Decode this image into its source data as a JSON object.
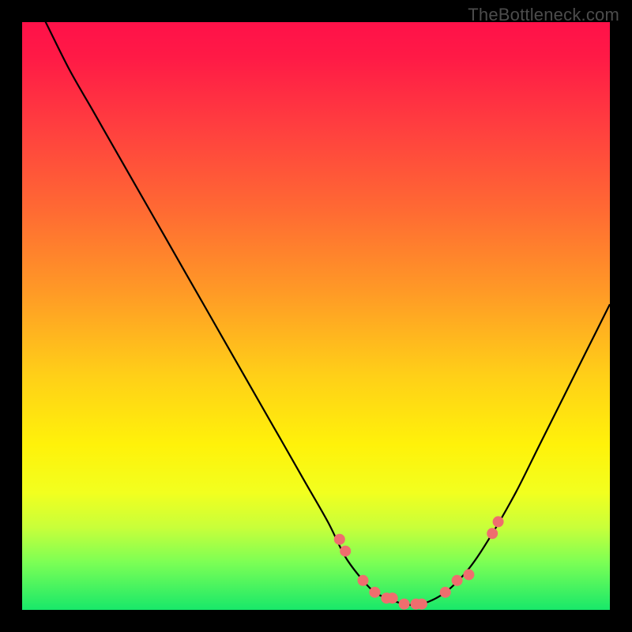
{
  "watermark": "TheBottleneck.com",
  "colors": {
    "curve": "#000000",
    "dot_fill": "#ef6e6e",
    "dot_stroke": "#b94848"
  },
  "chart_data": {
    "type": "line",
    "title": "",
    "xlabel": "",
    "ylabel": "",
    "xlim": [
      0,
      100
    ],
    "ylim": [
      0,
      100
    ],
    "grid": false,
    "legend": false,
    "annotations": [],
    "series": [
      {
        "name": "bottleneck-curve",
        "x": [
          0,
          4,
          8,
          12,
          16,
          20,
          24,
          28,
          32,
          36,
          40,
          44,
          48,
          52,
          55,
          58,
          60,
          62,
          65,
          68,
          72,
          76,
          80,
          84,
          88,
          92,
          96,
          100
        ],
        "y": [
          108,
          100,
          92,
          85,
          78,
          71,
          64,
          57,
          50,
          43,
          36,
          29,
          22,
          15,
          9,
          5,
          3,
          2,
          1,
          1,
          3,
          7,
          13,
          20,
          28,
          36,
          44,
          52
        ]
      }
    ],
    "marker_points": {
      "name": "highlight-dots",
      "x": [
        54,
        55,
        58,
        60,
        62,
        63,
        65,
        67,
        68,
        72,
        74,
        76,
        80,
        81
      ],
      "y": [
        12,
        10,
        5,
        3,
        2,
        2,
        1,
        1,
        1,
        3,
        5,
        6,
        13,
        15
      ]
    }
  }
}
